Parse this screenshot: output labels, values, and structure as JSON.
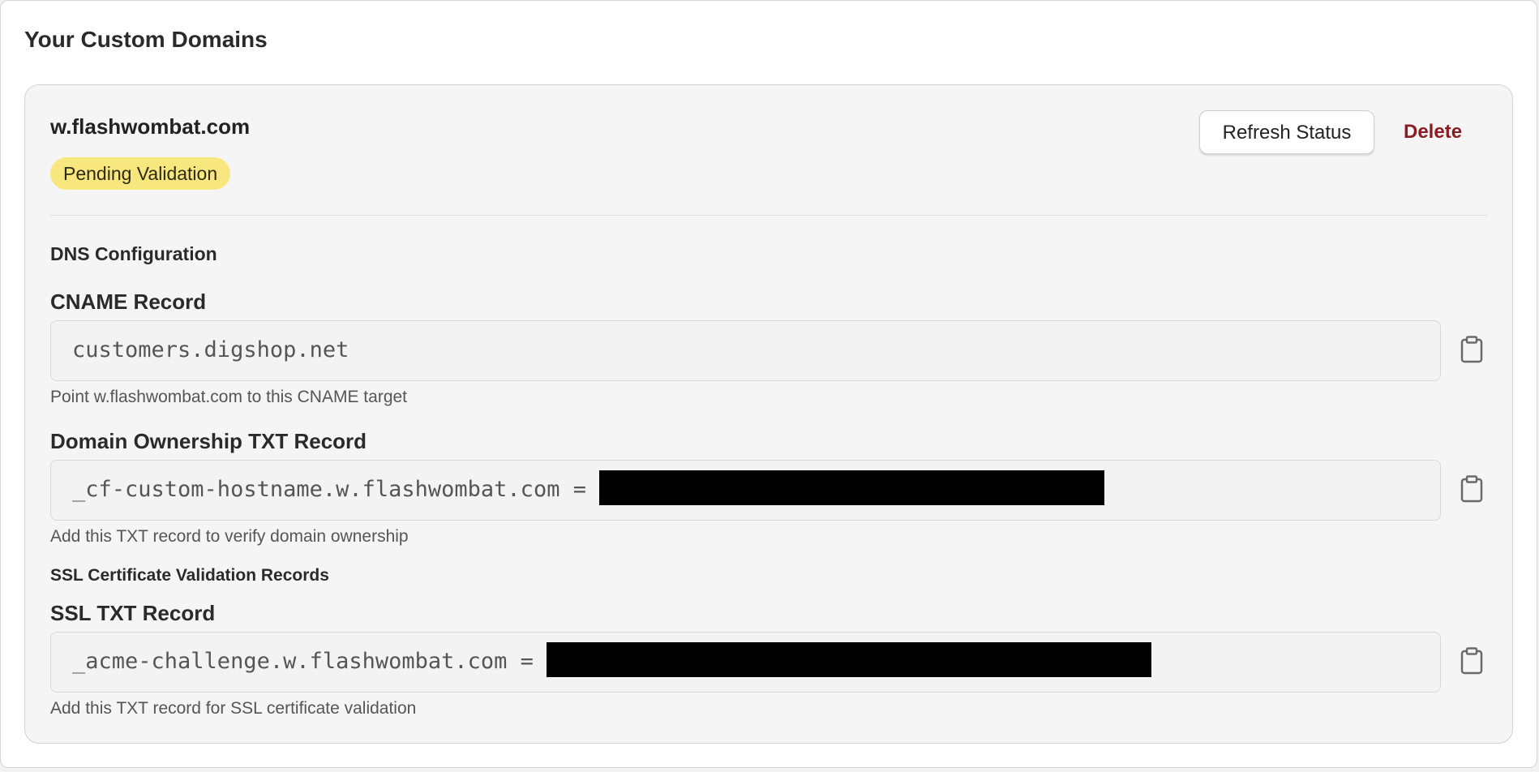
{
  "page": {
    "title": "Your Custom Domains"
  },
  "domain": {
    "name": "w.flashwombat.com",
    "status": "Pending Validation",
    "status_color": "#f8e67e",
    "actions": {
      "refresh_label": "Refresh Status",
      "delete_label": "Delete",
      "delete_color": "#8c1c24"
    }
  },
  "dns": {
    "heading": "DNS Configuration",
    "cname": {
      "label": "CNAME Record",
      "value": "customers.digshop.net",
      "hint": "Point w.flashwombat.com to this CNAME target",
      "copy_icon": "clipboard-icon"
    },
    "ownership_txt": {
      "label": "Domain Ownership TXT Record",
      "value_prefix": "_cf-custom-hostname.w.flashwombat.com = ",
      "value_redacted": true,
      "hint": "Add this TXT record to verify domain ownership",
      "copy_icon": "clipboard-icon"
    }
  },
  "ssl": {
    "heading": "SSL Certificate Validation Records",
    "txt": {
      "label": "SSL TXT Record",
      "value_prefix": "_acme-challenge.w.flashwombat.com = ",
      "value_redacted": true,
      "hint": "Add this TXT record for SSL certificate validation",
      "copy_icon": "clipboard-icon"
    }
  }
}
